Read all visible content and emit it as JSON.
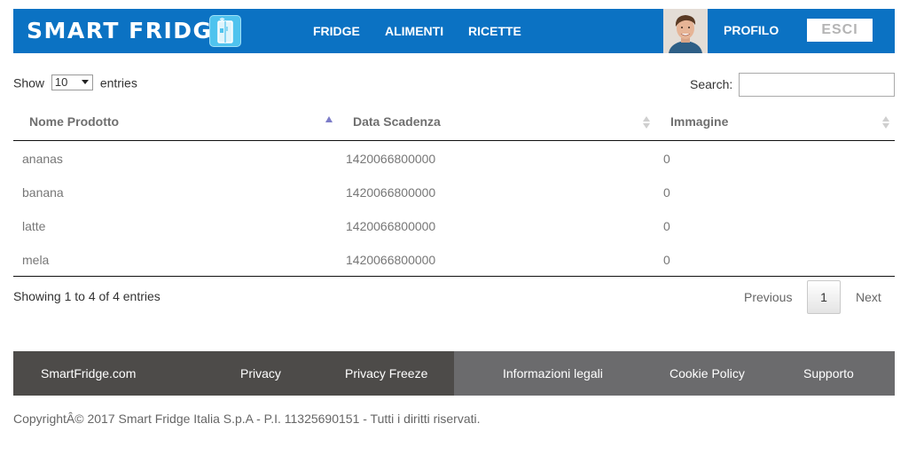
{
  "header": {
    "logo_text": "SMART FRIDGE",
    "nav": [
      {
        "label": "FRIDGE"
      },
      {
        "label": "ALIMENTI"
      },
      {
        "label": "RICETTE"
      }
    ],
    "profile_label": "PROFILO",
    "logout_label": "ESCI",
    "brand_color": "#0b72c3",
    "icons": [
      "fridge-icon",
      "avatar"
    ]
  },
  "table_controls": {
    "show_label": "Show",
    "page_length": "10",
    "entries_label": "entries",
    "search_label": "Search:",
    "search_value": ""
  },
  "table": {
    "columns": [
      {
        "label": "Nome Prodotto",
        "sort": "asc"
      },
      {
        "label": "Data Scadenza",
        "sort": "both"
      },
      {
        "label": "Immagine",
        "sort": "both"
      }
    ],
    "rows": [
      {
        "nome": "ananas",
        "data": "1420066800000",
        "immagine": "0"
      },
      {
        "nome": "banana",
        "data": "1420066800000",
        "immagine": "0"
      },
      {
        "nome": "latte",
        "data": "1420066800000",
        "immagine": "0"
      },
      {
        "nome": "mela",
        "data": "1420066800000",
        "immagine": "0"
      }
    ]
  },
  "pagination": {
    "info": "Showing 1 to 4 of 4 entries",
    "previous_label": "Previous",
    "current_page": "1",
    "next_label": "Next"
  },
  "footer": {
    "links": [
      {
        "label": "SmartFridge.com"
      },
      {
        "label": "Privacy"
      },
      {
        "label": "Privacy Freeze"
      },
      {
        "label": "Informazioni legali"
      },
      {
        "label": "Cookie Policy"
      },
      {
        "label": "Supporto"
      }
    ],
    "copyright": "CopyrightÂ© 2017 Smart Fridge Italia S.p.A - P.I. 11325690151 - Tutti i diritti riservati."
  }
}
